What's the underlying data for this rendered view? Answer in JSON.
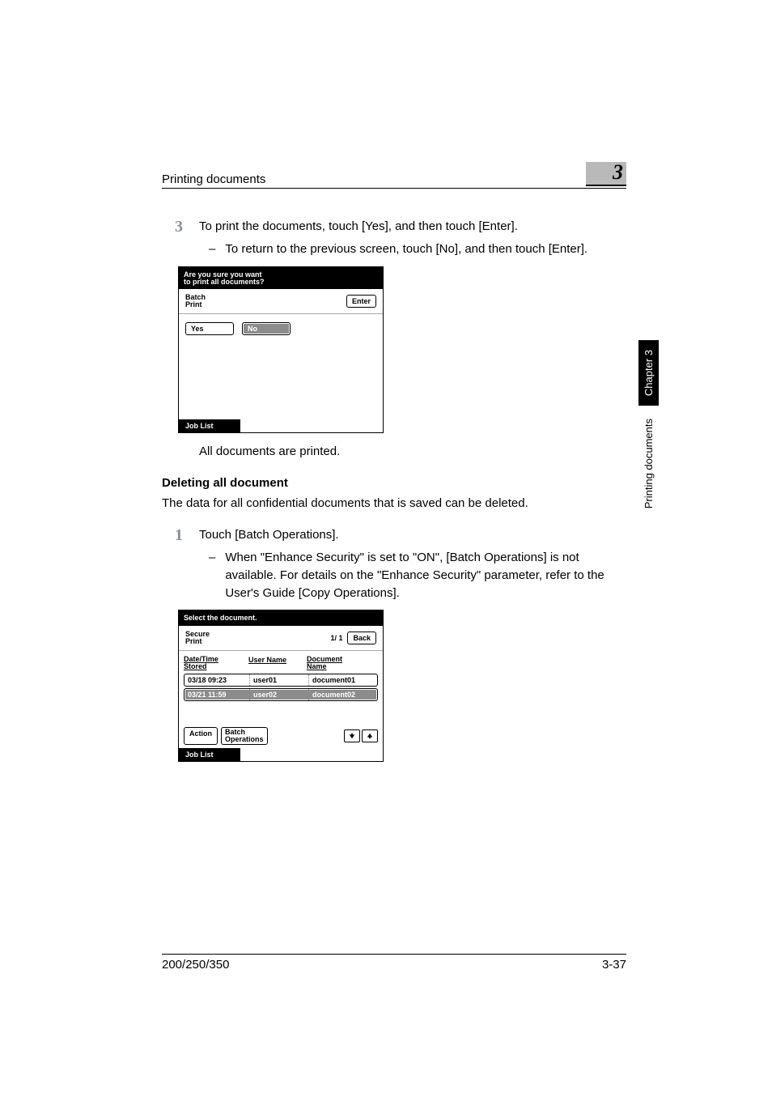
{
  "header": {
    "title": "Printing documents",
    "chapter_num": "3"
  },
  "side": {
    "chapter": "Chapter 3",
    "section": "Printing documents"
  },
  "step3": {
    "num": "3",
    "text": "To print the documents, touch [Yes], and then touch [Enter].",
    "sub": "To return to the previous screen, touch [No], and then touch [Enter]."
  },
  "screen1": {
    "title_l1": "Are you sure you want",
    "title_l2": "to print all documents?",
    "mode_l1": "Batch",
    "mode_l2": "Print",
    "enter": "Enter",
    "yes": "Yes",
    "no": "No",
    "joblist": "Job List"
  },
  "result_text": "All documents are printed.",
  "subheading": "Deleting all document",
  "delete_intro": "The data for all confidential documents that is saved can be deleted.",
  "step1": {
    "num": "1",
    "text": "Touch [Batch Operations].",
    "sub": "When \"Enhance Security\" is set to \"ON\", [Batch Operations] is not available. For details on the \"Enhance Security\" parameter, refer to the User's Guide [Copy Operations]."
  },
  "screen2": {
    "title": "Select the document.",
    "mode_l1": "Secure",
    "mode_l2": "Print",
    "page": "1/ 1",
    "back": "Back",
    "col1_l1": "Date/Time",
    "col1_l2": "Stored",
    "col2": "User Name",
    "col3_l1": "Document",
    "col3_l2": "Name",
    "rows": [
      {
        "dt": "03/18   09:23",
        "user": "user01",
        "doc": "document01"
      },
      {
        "dt": "03/21   11:59",
        "user": "user02",
        "doc": "document02"
      }
    ],
    "action": "Action",
    "batch_l1": "Batch",
    "batch_l2": "Operations",
    "joblist": "Job List"
  },
  "footer": {
    "left": "200/250/350",
    "right": "3-37"
  }
}
